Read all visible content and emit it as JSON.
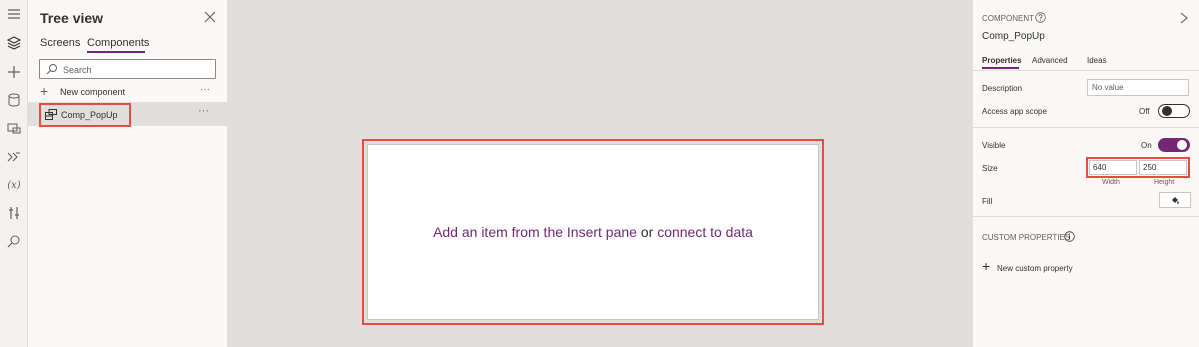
{
  "rail": {
    "items": [
      {
        "name": "hamburger-menu-icon"
      },
      {
        "name": "tree-view-icon"
      },
      {
        "name": "insert-plus-icon"
      },
      {
        "name": "data-icon"
      },
      {
        "name": "media-icon"
      },
      {
        "name": "power-automate-icon"
      },
      {
        "name": "variables-icon",
        "text": "(x)"
      },
      {
        "name": "advanced-tools-icon"
      },
      {
        "name": "search-icon"
      }
    ]
  },
  "tree": {
    "title": "Tree view",
    "tabs": {
      "screens": "Screens",
      "components": "Components"
    },
    "search": {
      "placeholder": "Search"
    },
    "new_component": {
      "label": "New component",
      "more": "···"
    },
    "components": [
      {
        "label": "Comp_PopUp",
        "more": "···"
      }
    ]
  },
  "canvas": {
    "message_part1": "Add an item from the Insert pane",
    "message_part2": "or",
    "message_part3": "connect to data"
  },
  "props": {
    "kind": "COMPONENT",
    "name": "Comp_PopUp",
    "tabs": {
      "properties": "Properties",
      "advanced": "Advanced",
      "ideas": "Ideas"
    },
    "description": {
      "label": "Description",
      "placeholder": "No value"
    },
    "access_app_scope": {
      "label": "Access app scope",
      "state": "Off"
    },
    "visible": {
      "label": "Visible",
      "state": "On"
    },
    "size": {
      "label": "Size",
      "width": "640",
      "height": "250",
      "width_caption": "Width",
      "height_caption": "Height"
    },
    "fill": {
      "label": "Fill"
    },
    "custom_properties": {
      "header": "CUSTOM PROPERTIES",
      "new_label": "New custom property"
    }
  },
  "colors": {
    "accent": "#742774",
    "highlight": "#e74c3c",
    "canvas_bg": "#e1dfdd"
  }
}
